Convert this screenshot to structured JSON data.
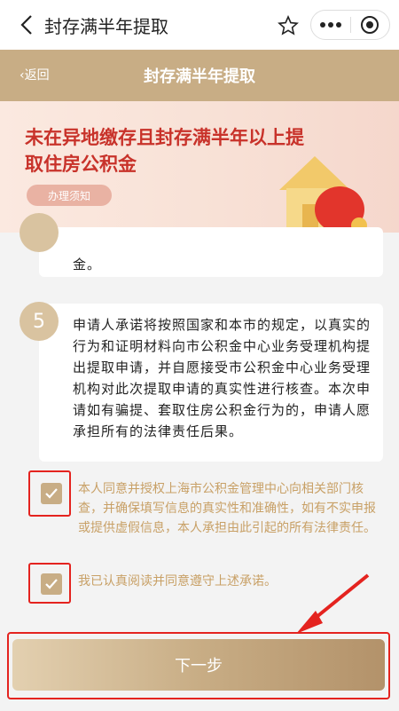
{
  "topbar": {
    "title": "封存满半年提取"
  },
  "header": {
    "back_label": "‹返回",
    "title": "封存满半年提取"
  },
  "banner": {
    "title": "未在异地缴存且封存满半年以上提取住房公积金",
    "notice_label": "办理须知",
    "coin_symbol": "¥"
  },
  "steps": [
    {
      "num": "",
      "text": "金。"
    },
    {
      "num": "5",
      "text": "申请人承诺将按照国家和本市的规定，以真实的行为和证明材料向市公积金中心业务受理机构提出提取申请，并自愿接受市公积金中心业务受理机构对此次提取申请的真实性进行核查。本次申请如有骗提、套取住房公积金行为的，申请人愿承担所有的法律责任后果。"
    }
  ],
  "agreements": [
    {
      "checked": true,
      "text": "本人同意并授权上海市公积金管理中心向相关部门核查，并确保填写信息的真实性和准确性，如有不实申报或提供虚假信息，本人承担由此引起的所有法律责任。"
    },
    {
      "checked": true,
      "text": "我已认真阅读并同意遵守上述承诺。"
    }
  ],
  "next_button": {
    "label": "下一步"
  },
  "colors": {
    "accent": "#c8ad85",
    "highlight": "#e4231f",
    "banner_title": "#c8322a"
  }
}
